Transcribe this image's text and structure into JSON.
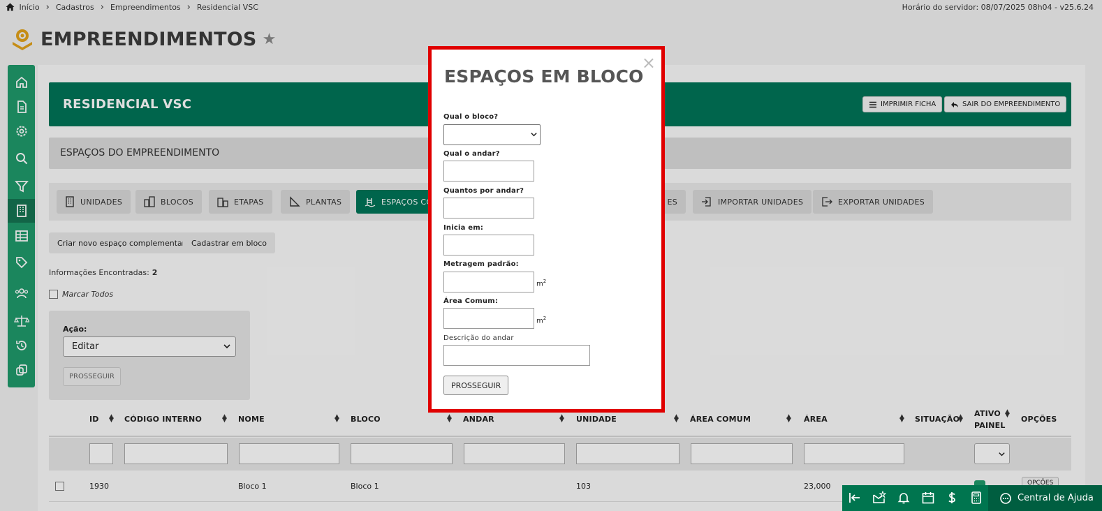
{
  "breadcrumb": {
    "items": [
      "Início",
      "Cadastros",
      "Empreendimentos",
      "Residencial VSC"
    ]
  },
  "server_time": "Horário do servidor: 08/07/2025 08h04 - v25.6.24",
  "page": {
    "title": "EMPREENDIMENTOS"
  },
  "sidebar": {
    "icons": [
      "home-icon",
      "document-icon",
      "settings-icon",
      "search-icon",
      "filter-icon",
      "building-icon",
      "table-icon",
      "tag-icon",
      "users-icon",
      "scale-icon",
      "history-icon",
      "copy-icon"
    ],
    "active_index": 5
  },
  "banner": {
    "title": "RESIDENCIAL VSC",
    "print_label": "IMPRIMIR FICHA",
    "exit_label": "SAIR DO EMPREENDIMENTO"
  },
  "section": {
    "title": "ESPAÇOS DO EMPREENDIMENTO"
  },
  "tabs": [
    {
      "label": "UNIDADES"
    },
    {
      "label": "BLOCOS"
    },
    {
      "label": "ETAPAS"
    },
    {
      "label": "PLANTAS"
    },
    {
      "label": "ESPAÇOS CO"
    },
    {
      "label": "ES"
    },
    {
      "label": "IMPORTAR UNIDADES"
    },
    {
      "label": "EXPORTAR UNIDADES"
    }
  ],
  "actions": {
    "new_space": "Criar novo espaço complementar",
    "bulk": "Cadastrar em bloco"
  },
  "info": {
    "label": "Informações Encontradas:",
    "count": "2"
  },
  "select_all": "Marcar Todos",
  "acao": {
    "label": "Ação:",
    "selected": "Editar",
    "button": "PROSSEGUIR"
  },
  "table": {
    "headers": [
      "ID",
      "CÓDIGO INTERNO",
      "NOME",
      "BLOCO",
      "ANDAR",
      "UNIDADE",
      "ÁREA COMUM",
      "ÁREA",
      "SITUAÇÃO",
      "ATIVO",
      "PAINEL",
      "OPÇÕES"
    ],
    "rows": [
      {
        "id": "1930",
        "codigo": "",
        "nome": "Bloco 1",
        "bloco": "Bloco 1",
        "andar": "",
        "unidade": "103",
        "area_comum": "",
        "area": "23,000",
        "opcoes": "OPÇÕES"
      }
    ]
  },
  "modal": {
    "title": "ESPAÇOS EM BLOCO",
    "close": "×",
    "fields": {
      "bloco": {
        "label": "Qual o bloco?",
        "value": ""
      },
      "andar": {
        "label": "Qual o andar?",
        "value": ""
      },
      "quantos": {
        "label": "Quantos por andar?",
        "value": ""
      },
      "inicia": {
        "label": "Inicia em:",
        "value": ""
      },
      "metragem": {
        "label": "Metragem padrão:",
        "unit": "m",
        "unit_sup": "2",
        "value": ""
      },
      "area_comum": {
        "label": "Área Comum:",
        "unit": "m",
        "unit_sup": "2",
        "value": ""
      },
      "descricao": {
        "label": "Descrição do andar",
        "value": ""
      }
    },
    "submit": "PROSSEGUIR"
  },
  "bottom_bar": {
    "help_label": "Central de Ajuda",
    "icons": [
      "collapse-icon",
      "mail-star-icon",
      "bell-icon",
      "calendar-icon",
      "dollar-icon",
      "calculator-icon"
    ]
  },
  "colors": {
    "primary_green": "#007558",
    "sidebar_green": "#1f9a6b",
    "highlight_red": "#e00000"
  }
}
